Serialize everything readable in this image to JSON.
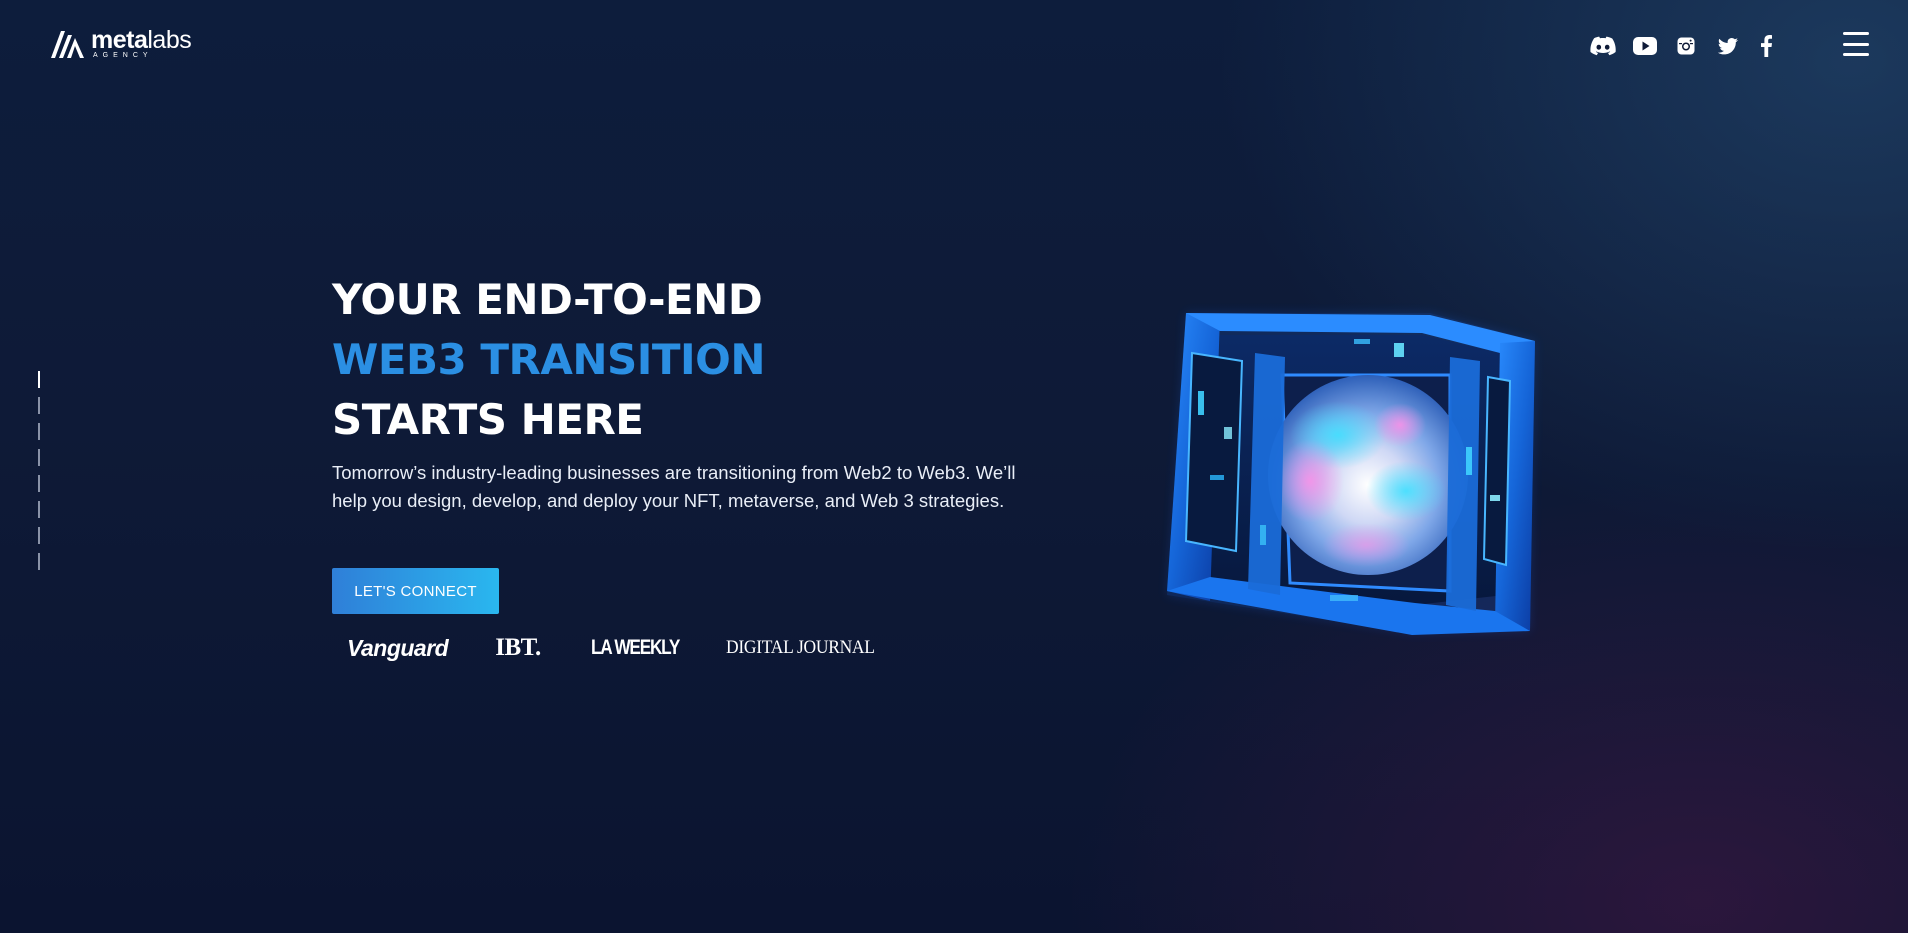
{
  "brand": {
    "name_bold": "meta",
    "name_light": "labs",
    "subtitle": "AGENCY",
    "logo_icon": "metalabs-logo-icon"
  },
  "header": {
    "social_links": [
      {
        "label": "Discord",
        "icon": "discord-icon"
      },
      {
        "label": "YouTube",
        "icon": "youtube-icon"
      },
      {
        "label": "Instagram",
        "icon": "instagram-icon"
      },
      {
        "label": "Twitter",
        "icon": "twitter-icon"
      },
      {
        "label": "Facebook",
        "icon": "facebook-icon"
      }
    ],
    "menu_icon": "hamburger-menu-icon"
  },
  "pager": {
    "count": 8,
    "active_index": 0
  },
  "hero": {
    "title_line1": "YOUR END-TO-END",
    "title_line2": "WEB3 TRANSITION",
    "title_line3": "STARTS HERE",
    "description": "Tomorrow’s industry-leading businesses are transitioning from Web2 to Web3. We’ll help you design, develop, and deploy your NFT, metaverse, and Web 3 strategies.",
    "cta_label": "LET'S CONNECT",
    "art_icon": "glass-cube-sphere-illustration"
  },
  "press": {
    "logos": [
      "Vanguard",
      "IBT.",
      "LA WEEKLY",
      "DIGITAL JOURNAL"
    ]
  },
  "colors": {
    "background": "#0e1a37",
    "accent_blue": "#2b8fe3",
    "cta_start": "#2f7fd8",
    "cta_end": "#2ab7ef",
    "text": "#ffffff"
  }
}
